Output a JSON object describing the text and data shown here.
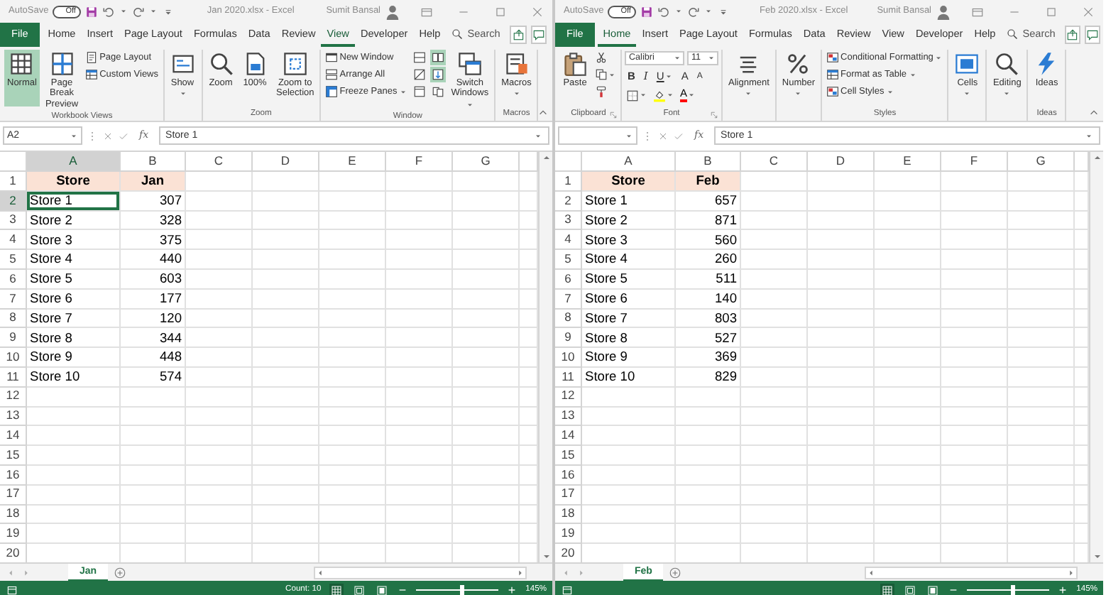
{
  "windows": [
    {
      "title_bar": {
        "autosave": "AutoSave",
        "toggle": {
          "label": "Off",
          "on": false
        },
        "title": "Jan 2020.xlsx  -  Excel",
        "user": "Sumit Bansal"
      },
      "tabs": [
        {
          "label": "File",
          "kind": "file",
          "selected": false
        },
        {
          "label": "Home",
          "kind": "tab",
          "selected": false
        },
        {
          "label": "Insert",
          "kind": "tab",
          "selected": false
        },
        {
          "label": "Page Layout",
          "kind": "tab",
          "selected": false
        },
        {
          "label": "Formulas",
          "kind": "tab",
          "selected": false
        },
        {
          "label": "Data",
          "kind": "tab",
          "selected": false
        },
        {
          "label": "Review",
          "kind": "tab",
          "selected": false
        },
        {
          "label": "View",
          "kind": "tab",
          "selected": true
        },
        {
          "label": "Developer",
          "kind": "tab",
          "selected": false
        },
        {
          "label": "Help",
          "kind": "tab",
          "selected": false
        }
      ],
      "search": "Search",
      "ribbon": [
        {
          "label": "Workbook Views",
          "columns": [
            [
              {
                "kind": "large",
                "label": "Normal",
                "selected": true
              }
            ],
            [
              {
                "kind": "large",
                "label": "Page Break\nPreview",
                "selected": false
              }
            ],
            [
              {
                "kind": "small",
                "label": "Page Layout",
                "selected": false
              },
              {
                "kind": "small",
                "label": "Custom Views",
                "selected": false
              }
            ]
          ]
        },
        {
          "columns": [
            [
              {
                "kind": "large",
                "label": "Show",
                "caret": true,
                "selected": false
              }
            ]
          ]
        },
        {
          "label": "Zoom",
          "columns": [
            [
              {
                "kind": "large",
                "label": "Zoom",
                "selected": false
              }
            ],
            [
              {
                "kind": "large",
                "label": "100%",
                "selected": false
              }
            ],
            [
              {
                "kind": "large",
                "label": "Zoom to\nSelection",
                "selected": false
              }
            ]
          ]
        },
        {
          "label": "Window",
          "columns": [
            [
              {
                "kind": "small",
                "label": "New Window",
                "selected": false
              },
              {
                "kind": "small",
                "label": "Arrange All",
                "selected": false
              },
              {
                "kind": "small",
                "label": "Freeze Panes",
                "caret": true,
                "selected": false
              }
            ],
            [
              {
                "kind": "icon",
                "selected": false
              },
              {
                "kind": "icon",
                "selected": false
              },
              {
                "kind": "icon",
                "selected": false
              }
            ],
            [
              {
                "kind": "icon",
                "selected": true
              },
              {
                "kind": "icon",
                "selected": true
              },
              {
                "kind": "icon",
                "selected": false
              }
            ],
            [
              {
                "kind": "large",
                "label": "Switch\nWindows",
                "caret": true,
                "selected": false
              }
            ]
          ]
        },
        {
          "label": "Macros",
          "columns": [
            [
              {
                "kind": "large",
                "label": "Macros",
                "caret": true,
                "selected": false
              }
            ]
          ]
        }
      ],
      "name_box": "A2",
      "fx": "fx",
      "formula": "Store 1",
      "columns": [
        "A",
        "B",
        "C",
        "D",
        "E",
        "F",
        "G"
      ],
      "rows": [
        {
          "number": "1",
          "header": true,
          "cells": [
            {
              "text": "Store",
              "selected": false
            },
            {
              "text": "Jan",
              "selected": false
            }
          ]
        },
        {
          "number": "2",
          "header": false,
          "cells": [
            {
              "text": "Store 1",
              "selected": true
            },
            {
              "text": "307",
              "selected": false
            }
          ]
        },
        {
          "number": "3",
          "header": false,
          "cells": [
            {
              "text": "Store 2",
              "selected": false
            },
            {
              "text": "328",
              "selected": false
            }
          ]
        },
        {
          "number": "4",
          "header": false,
          "cells": [
            {
              "text": "Store 3",
              "selected": false
            },
            {
              "text": "375",
              "selected": false
            }
          ]
        },
        {
          "number": "5",
          "header": false,
          "cells": [
            {
              "text": "Store 4",
              "selected": false
            },
            {
              "text": "440",
              "selected": false
            }
          ]
        },
        {
          "number": "6",
          "header": false,
          "cells": [
            {
              "text": "Store 5",
              "selected": false
            },
            {
              "text": "603",
              "selected": false
            }
          ]
        },
        {
          "number": "7",
          "header": false,
          "cells": [
            {
              "text": "Store 6",
              "selected": false
            },
            {
              "text": "177",
              "selected": false
            }
          ]
        },
        {
          "number": "8",
          "header": false,
          "cells": [
            {
              "text": "Store 7",
              "selected": false
            },
            {
              "text": "120",
              "selected": false
            }
          ]
        },
        {
          "number": "9",
          "header": false,
          "cells": [
            {
              "text": "Store 8",
              "selected": false
            },
            {
              "text": "344",
              "selected": false
            }
          ]
        },
        {
          "number": "10",
          "header": false,
          "cells": [
            {
              "text": "Store 9",
              "selected": false
            },
            {
              "text": "448",
              "selected": false
            }
          ]
        },
        {
          "number": "11",
          "header": false,
          "cells": [
            {
              "text": "Store 10",
              "selected": false
            },
            {
              "text": "574",
              "selected": false
            }
          ]
        },
        {
          "number": "12"
        },
        {
          "number": "13"
        },
        {
          "number": "14"
        },
        {
          "number": "15"
        },
        {
          "number": "16"
        },
        {
          "number": "17"
        },
        {
          "number": "18"
        },
        {
          "number": "19"
        },
        {
          "number": "20"
        }
      ],
      "sheet_tabs": [
        {
          "label": "Jan",
          "selected": true
        }
      ],
      "status_bar": {
        "count": "Count: 10",
        "views": [
          {
            "selected": true
          },
          {
            "selected": false
          },
          {
            "selected": false
          }
        ],
        "zoom": {
          "level": 0.55,
          "reading": "145%"
        }
      }
    },
    {
      "title_bar": {
        "autosave": "AutoSave",
        "toggle": {
          "label": "Off",
          "on": false
        },
        "title": "Feb 2020.xlsx  -  Excel",
        "user": "Sumit Bansal"
      },
      "tabs": [
        {
          "label": "File",
          "kind": "file",
          "selected": false
        },
        {
          "label": "Home",
          "kind": "tab",
          "selected": true
        },
        {
          "label": "Insert",
          "kind": "tab",
          "selected": false
        },
        {
          "label": "Page Layout",
          "kind": "tab",
          "selected": false
        },
        {
          "label": "Formulas",
          "kind": "tab",
          "selected": false
        },
        {
          "label": "Data",
          "kind": "tab",
          "selected": false
        },
        {
          "label": "Review",
          "kind": "tab",
          "selected": false
        },
        {
          "label": "View",
          "kind": "tab",
          "selected": false
        },
        {
          "label": "Developer",
          "kind": "tab",
          "selected": false
        },
        {
          "label": "Help",
          "kind": "tab",
          "selected": false
        }
      ],
      "search": "Search",
      "ribbon": [
        {
          "label": "Clipboard",
          "launcher": true,
          "columns": [
            [
              {
                "kind": "large",
                "label": "Paste",
                "selected": false
              }
            ],
            [
              {
                "kind": "icon",
                "selected": false
              },
              {
                "kind": "icon",
                "caret": true,
                "selected": false
              },
              {
                "kind": "icon",
                "selected": false
              }
            ]
          ]
        },
        {
          "label": "Font",
          "launcher": true,
          "columns": [
            [
              {
                "kind": "row",
                "items": [
                  {
                    "kind": "field",
                    "value": "Calibri"
                  },
                  {
                    "kind": "field",
                    "value": "11"
                  }
                ]
              },
              {
                "kind": "row",
                "items": [
                  {
                    "kind": "glyph",
                    "label": "B",
                    "selected": false
                  },
                  {
                    "kind": "glyph",
                    "label": "I",
                    "selected": false
                  },
                  {
                    "kind": "glyph",
                    "label": "U",
                    "caret": true,
                    "selected": false
                  },
                  {
                    "kind": "glyph",
                    "label": "A",
                    "selected": false
                  },
                  {
                    "kind": "glyph",
                    "label": "A",
                    "selected": false
                  }
                ]
              },
              {
                "kind": "row",
                "items": [
                  {
                    "kind": "icon",
                    "caret": true,
                    "selected": false
                  },
                  {
                    "kind": "icon",
                    "caret": true,
                    "selected": false
                  },
                  {
                    "kind": "color",
                    "label": "A",
                    "color": "#ff0000",
                    "caret": true,
                    "selected": false
                  }
                ]
              }
            ]
          ]
        },
        {
          "columns": [
            [
              {
                "kind": "large",
                "label": "Alignment",
                "caret": true,
                "selected": false
              }
            ]
          ]
        },
        {
          "columns": [
            [
              {
                "kind": "large",
                "label": "Number",
                "caret": true,
                "selected": false
              }
            ]
          ]
        },
        {
          "label": "Styles",
          "columns": [
            [
              {
                "kind": "small",
                "label": "Conditional Formatting",
                "caret": true,
                "selected": false
              },
              {
                "kind": "small",
                "label": "Format as Table",
                "caret": true,
                "selected": false
              },
              {
                "kind": "small",
                "label": "Cell Styles",
                "caret": true,
                "selected": false
              }
            ]
          ]
        },
        {
          "columns": [
            [
              {
                "kind": "large",
                "label": "Cells",
                "caret": true,
                "selected": false
              }
            ]
          ]
        },
        {
          "columns": [
            [
              {
                "kind": "large",
                "label": "Editing",
                "caret": true,
                "selected": false
              }
            ]
          ]
        },
        {
          "label": "Ideas",
          "columns": [
            [
              {
                "kind": "large",
                "label": "Ideas",
                "selected": false
              }
            ]
          ]
        }
      ],
      "fx": "fx",
      "formula": "Store 1",
      "columns": [
        "A",
        "B",
        "C",
        "D",
        "E",
        "F",
        "G"
      ],
      "rows": [
        {
          "number": "1",
          "header": true,
          "cells": [
            {
              "text": "Store",
              "selected": false
            },
            {
              "text": "Feb",
              "selected": false
            }
          ]
        },
        {
          "number": "2",
          "header": false,
          "cells": [
            {
              "text": "Store 1",
              "selected": false
            },
            {
              "text": "657",
              "selected": false
            }
          ]
        },
        {
          "number": "3",
          "header": false,
          "cells": [
            {
              "text": "Store 2",
              "selected": false
            },
            {
              "text": "871",
              "selected": false
            }
          ]
        },
        {
          "number": "4",
          "header": false,
          "cells": [
            {
              "text": "Store 3",
              "selected": false
            },
            {
              "text": "560",
              "selected": false
            }
          ]
        },
        {
          "number": "5",
          "header": false,
          "cells": [
            {
              "text": "Store 4",
              "selected": false
            },
            {
              "text": "260",
              "selected": false
            }
          ]
        },
        {
          "number": "6",
          "header": false,
          "cells": [
            {
              "text": "Store 5",
              "selected": false
            },
            {
              "text": "511",
              "selected": false
            }
          ]
        },
        {
          "number": "7",
          "header": false,
          "cells": [
            {
              "text": "Store 6",
              "selected": false
            },
            {
              "text": "140",
              "selected": false
            }
          ]
        },
        {
          "number": "8",
          "header": false,
          "cells": [
            {
              "text": "Store 7",
              "selected": false
            },
            {
              "text": "803",
              "selected": false
            }
          ]
        },
        {
          "number": "9",
          "header": false,
          "cells": [
            {
              "text": "Store 8",
              "selected": false
            },
            {
              "text": "527",
              "selected": false
            }
          ]
        },
        {
          "number": "10",
          "header": false,
          "cells": [
            {
              "text": "Store 9",
              "selected": false
            },
            {
              "text": "369",
              "selected": false
            }
          ]
        },
        {
          "number": "11",
          "header": false,
          "cells": [
            {
              "text": "Store 10",
              "selected": false
            },
            {
              "text": "829",
              "selected": false
            }
          ]
        },
        {
          "number": "12"
        },
        {
          "number": "13"
        },
        {
          "number": "14"
        },
        {
          "number": "15"
        },
        {
          "number": "16"
        },
        {
          "number": "17"
        },
        {
          "number": "18"
        },
        {
          "number": "19"
        },
        {
          "number": "20"
        }
      ],
      "sheet_tabs": [
        {
          "label": "Feb",
          "selected": true
        }
      ],
      "status_bar": {
        "views": [
          {
            "selected": true
          },
          {
            "selected": false
          },
          {
            "selected": false
          }
        ],
        "zoom": {
          "level": 0.55,
          "reading": "145%"
        }
      }
    }
  ]
}
